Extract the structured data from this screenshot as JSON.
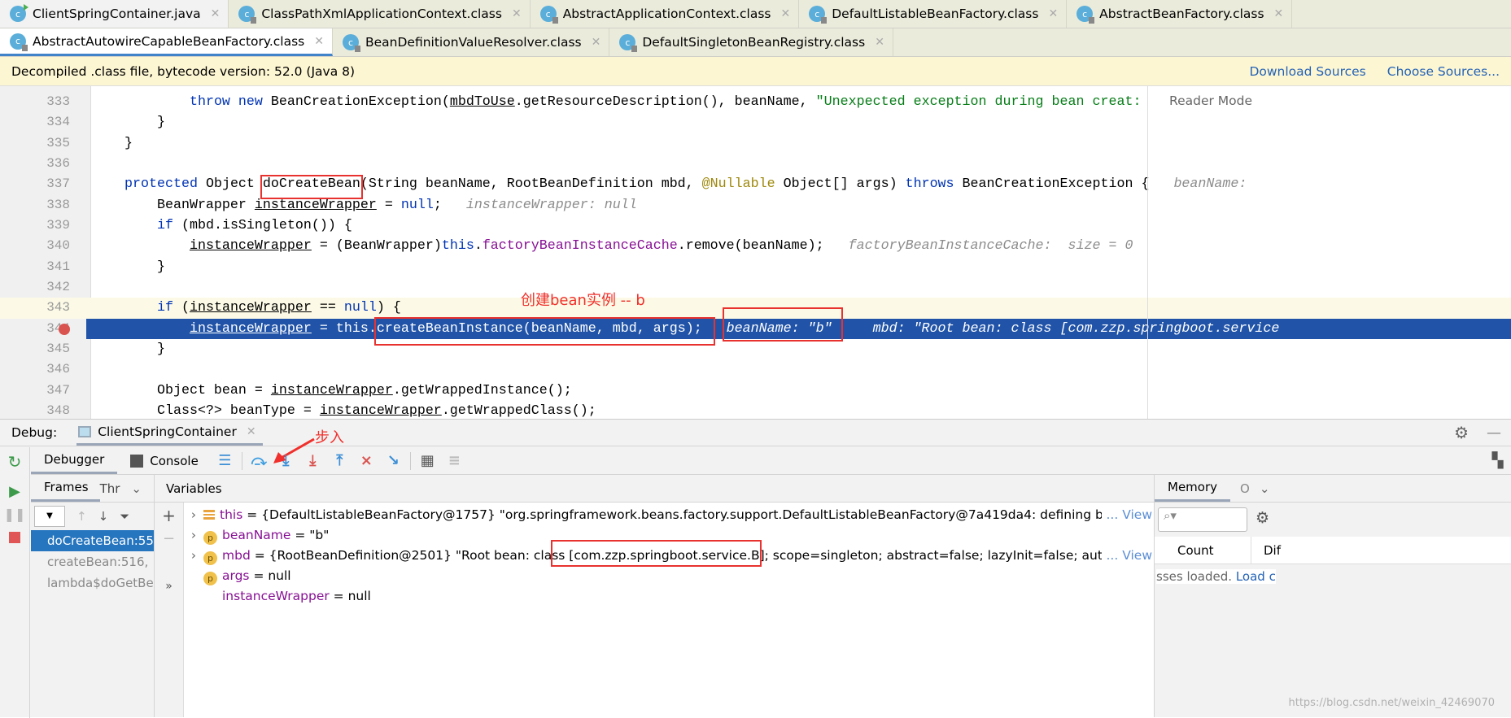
{
  "tabs_row1": [
    {
      "label": "ClientSpringContainer.java",
      "type": "java"
    },
    {
      "label": "ClassPathXmlApplicationContext.class",
      "type": "class"
    },
    {
      "label": "AbstractApplicationContext.class",
      "type": "class"
    },
    {
      "label": "DefaultListableBeanFactory.class",
      "type": "class"
    },
    {
      "label": "AbstractBeanFactory.class",
      "type": "class"
    }
  ],
  "tabs_row2": [
    {
      "label": "AbstractAutowireCapableBeanFactory.class",
      "type": "class",
      "active": true
    },
    {
      "label": "BeanDefinitionValueResolver.class",
      "type": "class"
    },
    {
      "label": "DefaultSingletonBeanRegistry.class",
      "type": "class"
    }
  ],
  "banner": {
    "text": "Decompiled .class file, bytecode version: 52.0 (Java 8)",
    "download": "Download Sources",
    "choose": "Choose Sources..."
  },
  "editor": {
    "reader_mode": "Reader Mode",
    "lines": [
      {
        "n": "333",
        "tokens": [
          [
            "            ",
            ""
          ],
          [
            "throw new ",
            "kw"
          ],
          [
            "BeanCreationException(",
            ""
          ],
          [
            "mbdToUse",
            "ul"
          ],
          [
            ".getResourceDescription(), beanName, ",
            ""
          ],
          [
            "\"Unexpected exception during bean creat:",
            "str"
          ]
        ]
      },
      {
        "n": "334",
        "tokens": [
          [
            "        }",
            ""
          ]
        ]
      },
      {
        "n": "335",
        "tokens": [
          [
            "    }",
            ""
          ]
        ]
      },
      {
        "n": "336",
        "tokens": []
      },
      {
        "n": "337",
        "tokens": [
          [
            "    ",
            ""
          ],
          [
            "protected ",
            "kw"
          ],
          [
            "Object doCreateBean(String beanName, RootBeanDefinition mbd, ",
            ""
          ],
          [
            "@Nullable",
            "an"
          ],
          [
            " Object[] args) ",
            ""
          ],
          [
            "throws ",
            "kw"
          ],
          [
            "BeanCreationException {   ",
            ""
          ],
          [
            "beanName: ",
            "hint"
          ]
        ]
      },
      {
        "n": "338",
        "tokens": [
          [
            "        BeanWrapper ",
            ""
          ],
          [
            "instanceWrapper",
            "ul"
          ],
          [
            " = ",
            ""
          ],
          [
            "null",
            "kw"
          ],
          [
            ";   ",
            ""
          ],
          [
            "instanceWrapper: null",
            "hint"
          ]
        ]
      },
      {
        "n": "339",
        "tokens": [
          [
            "        ",
            ""
          ],
          [
            "if ",
            "kw"
          ],
          [
            "(mbd.isSingleton()) {",
            ""
          ]
        ]
      },
      {
        "n": "340",
        "tokens": [
          [
            "            ",
            ""
          ],
          [
            "instanceWrapper",
            "ul"
          ],
          [
            " = (BeanWrapper)",
            ""
          ],
          [
            "this",
            "kw"
          ],
          [
            ".",
            ""
          ],
          [
            "factoryBeanInstanceCache",
            "fd"
          ],
          [
            ".remove(beanName);   ",
            ""
          ],
          [
            "factoryBeanInstanceCache:  size = 0",
            "hint"
          ]
        ]
      },
      {
        "n": "341",
        "tokens": [
          [
            "        }",
            ""
          ]
        ]
      },
      {
        "n": "342",
        "tokens": []
      },
      {
        "n": "343",
        "tokens": [
          [
            "        ",
            ""
          ],
          [
            "if ",
            "kw"
          ],
          [
            "(",
            ""
          ],
          [
            "instanceWrapper",
            "ul"
          ],
          [
            " == ",
            ""
          ],
          [
            "null",
            "kw"
          ],
          [
            ") {",
            ""
          ]
        ],
        "current": true
      },
      {
        "n": "344",
        "tokens": [
          [
            "            ",
            ""
          ],
          [
            "instanceWrapper",
            "ul"
          ],
          [
            " = ",
            ""
          ],
          [
            "this",
            ""
          ],
          [
            ".createBeanInstance(beanName, mbd, args);   ",
            ""
          ],
          [
            "beanName: \"b\"     mbd: \"Root bean: class [com.zzp.springboot.service",
            "hint"
          ]
        ],
        "highlight": true
      },
      {
        "n": "345",
        "tokens": [
          [
            "        }",
            ""
          ]
        ]
      },
      {
        "n": "346",
        "tokens": []
      },
      {
        "n": "347",
        "tokens": [
          [
            "        Object bean = ",
            ""
          ],
          [
            "instanceWrapper",
            "ul"
          ],
          [
            ".getWrappedInstance();",
            ""
          ]
        ]
      },
      {
        "n": "348",
        "tokens": [
          [
            "        Class<?> beanType = ",
            ""
          ],
          [
            "instanceWrapper",
            "ul"
          ],
          [
            ".getWrappedClass();",
            ""
          ]
        ]
      }
    ]
  },
  "annotations": {
    "create_instance": "创建bean实例 -- b",
    "step_into": "步入"
  },
  "debug": {
    "label": "Debug:",
    "session": "ClientSpringContainer",
    "toolbar": {
      "debugger": "Debugger",
      "console": "Console"
    },
    "frames_tab": "Frames",
    "threads_tab": "Thr",
    "frames": [
      "doCreateBean:55",
      "createBean:516,",
      "lambda$doGetBe"
    ],
    "variables_label": "Variables",
    "variables": [
      {
        "expand": true,
        "icon": "field",
        "name": "this",
        "value": " = {DefaultListableBeanFactory@1757} \"org.springframework.beans.factory.support.DefaultListableBeanFactory@7a419da4: defining bea",
        "view": "... View"
      },
      {
        "expand": true,
        "icon": "param",
        "name": "beanName",
        "value": " = \"b\""
      },
      {
        "expand": true,
        "icon": "param",
        "name": "mbd",
        "value": " = {RootBeanDefinition@2501} \"Root bean: class [com.zzp.springboot.service.B]; scope=singleton; abstract=false; lazyInit=false; autowir",
        "view": "... View"
      },
      {
        "expand": false,
        "icon": "param",
        "name": "args",
        "value": " = null"
      },
      {
        "expand": false,
        "icon": "none",
        "name": "instanceWrapper",
        "value": " = null"
      }
    ],
    "memory": {
      "tab": "Memory",
      "other_tab": "O",
      "count": "Count",
      "diff": "Dif",
      "status": "sses loaded.",
      "load": "Load c"
    }
  },
  "watermark": "https://blog.csdn.net/weixin_42469070",
  "colors": {
    "accent": "#2154a8",
    "annotation": "#e8322f",
    "selection": "#2675bf"
  }
}
